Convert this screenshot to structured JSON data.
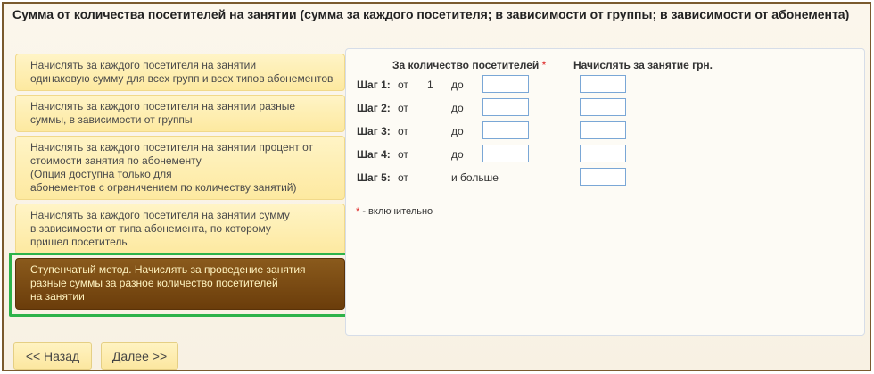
{
  "title": "Сумма от количества посетителей на занятии (сумма за каждого посетителя; в зависимости от группы; в зависимости от абонемента)",
  "options": [
    {
      "label": "Начислять за каждого посетителя на занятии\nодинаковую сумму для всех групп и всех типов абонементов",
      "selected": false
    },
    {
      "label": "Начислять за каждого посетителя на занятии разные\nсуммы, в зависимости от группы",
      "selected": false
    },
    {
      "label": "Начислять за каждого посетителя на занятии процент от\nстоимости занятия по абонементу\n(Опция доступна только для\nабонементов с ограничением по количеству занятий)",
      "selected": false
    },
    {
      "label": "Начислять за каждого посетителя на занятии сумму\nв зависимости от типа абонемента, по которому\nпришел посетитель",
      "selected": false
    },
    {
      "label": "Ступенчатый метод. Начислять за проведение занятия\nразные суммы за разное количество посетителей\nна занятии",
      "selected": true
    }
  ],
  "panel": {
    "col1_header": "За количество посетителей",
    "required_mark": "*",
    "col2_header": "Начислять за занятие грн.",
    "steps": [
      {
        "label": "Шаг 1:",
        "from_label": "от",
        "from_value": "1",
        "to_label": "до",
        "to_value": "",
        "amount": ""
      },
      {
        "label": "Шаг 2:",
        "from_label": "от",
        "from_value": "",
        "to_label": "до",
        "to_value": "",
        "amount": ""
      },
      {
        "label": "Шаг 3:",
        "from_label": "от",
        "from_value": "",
        "to_label": "до",
        "to_value": "",
        "amount": ""
      },
      {
        "label": "Шаг 4:",
        "from_label": "от",
        "from_value": "",
        "to_label": "до",
        "to_value": "",
        "amount": ""
      },
      {
        "label": "Шаг 5:",
        "from_label": "от",
        "from_value": "",
        "to_label": "и больше",
        "to_value": null,
        "amount": ""
      }
    ],
    "note_mark": "*",
    "note_text": " - включительно"
  },
  "buttons": {
    "back": "<< Назад",
    "next": "Далее >>"
  },
  "colors": {
    "option_bg": "#fde9a0",
    "option_active_bg": "#6b3d0b",
    "highlight": "#2db34a",
    "input_border": "#7aa7d6"
  }
}
